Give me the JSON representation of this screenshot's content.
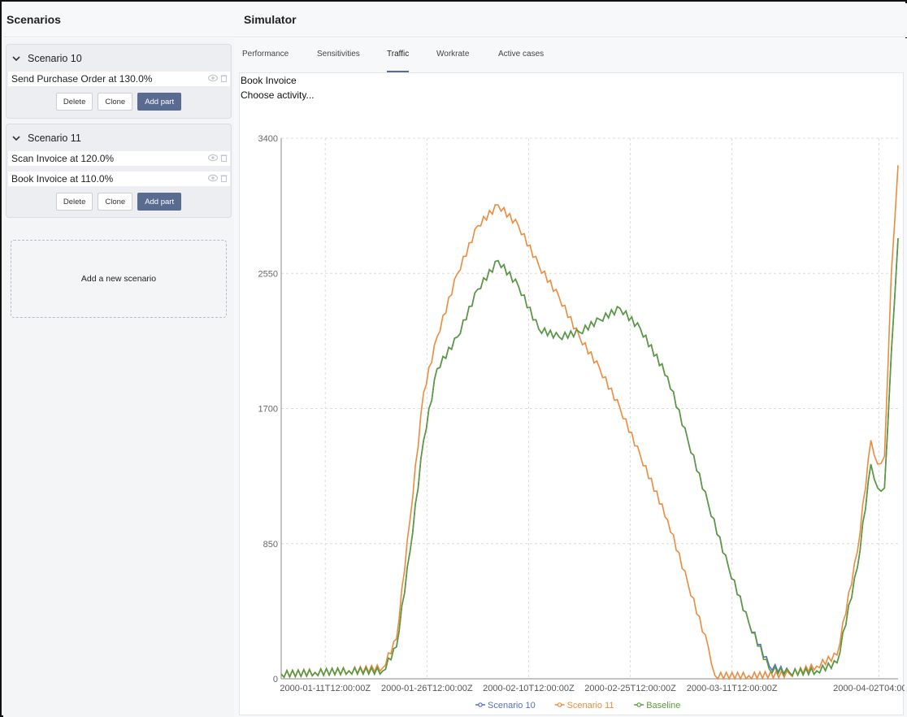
{
  "header": {
    "left_title": "Scenarios",
    "right_title": "Simulator"
  },
  "scenarios": [
    {
      "title": "Scenario 10",
      "parts": [
        {
          "label": "Send Purchase Order at 130.0%"
        }
      ],
      "buttons": {
        "delete": "Delete",
        "clone": "Clone",
        "add": "Add part"
      }
    },
    {
      "title": "Scenario 11",
      "parts": [
        {
          "label": "Scan Invoice at 120.0%"
        },
        {
          "label": "Book Invoice at 110.0%"
        }
      ],
      "buttons": {
        "delete": "Delete",
        "clone": "Clone",
        "add": "Add part"
      }
    }
  ],
  "new_scenario_label": "Add a new scenario",
  "tabs": [
    {
      "label": "Performance",
      "active": false
    },
    {
      "label": "Sensitivities",
      "active": false
    },
    {
      "label": "Traffic",
      "active": true
    },
    {
      "label": "Workrate",
      "active": false
    },
    {
      "label": "Active cases",
      "active": false
    }
  ],
  "activity": {
    "name": "Book Invoice",
    "chooser_placeholder": "Choose activity..."
  },
  "colors": {
    "accent": "#5a6b92",
    "scenario10": "#5470c6",
    "scenario11": "#ee8a3c",
    "baseline": "#5a9a3a"
  },
  "chart_data": {
    "type": "line",
    "title": "",
    "xlabel": "",
    "ylabel": "",
    "ylim": [
      0,
      3400
    ],
    "yticks": [
      0,
      850,
      1700,
      2550,
      3400
    ],
    "xticks": [
      "2000-01-11T12:00:00Z",
      "2000-01-26T12:00:00Z",
      "2000-02-10T12:00:00Z",
      "2000-02-25T12:00:00Z",
      "2000-03-11T12:00:00Z",
      "2000-04-02T04:00:00Z"
    ],
    "x_start": "2000-01-05T00:00:00Z",
    "x_end": "2000-04-05T00:00:00Z",
    "grid": true,
    "legend_position": "bottom-center",
    "series": [
      {
        "name": "Scenario 10",
        "color": "#5470c6",
        "points": [
          [
            "2000-01-05",
            30
          ],
          [
            "2000-01-10",
            40
          ],
          [
            "2000-01-15",
            50
          ],
          [
            "2000-01-20",
            50
          ],
          [
            "2000-01-22",
            200
          ],
          [
            "2000-01-24",
            800
          ],
          [
            "2000-01-26",
            1500
          ],
          [
            "2000-01-28",
            1950
          ],
          [
            "2000-01-31",
            2150
          ],
          [
            "2000-02-03",
            2450
          ],
          [
            "2000-02-06",
            2630
          ],
          [
            "2000-02-09",
            2470
          ],
          [
            "2000-02-12",
            2200
          ],
          [
            "2000-02-15",
            2150
          ],
          [
            "2000-02-18",
            2180
          ],
          [
            "2000-02-21",
            2260
          ],
          [
            "2000-02-24",
            2330
          ],
          [
            "2000-02-27",
            2200
          ],
          [
            "2000-03-02",
            1900
          ],
          [
            "2000-03-05",
            1500
          ],
          [
            "2000-03-08",
            1100
          ],
          [
            "2000-03-11",
            700
          ],
          [
            "2000-03-14",
            350
          ],
          [
            "2000-03-17",
            80
          ],
          [
            "2000-03-20",
            40
          ],
          [
            "2000-03-24",
            50
          ],
          [
            "2000-03-27",
            100
          ],
          [
            "2000-03-30",
            700
          ],
          [
            "2000-04-01",
            1350
          ],
          [
            "2000-04-02",
            1200
          ],
          [
            "2000-04-03",
            1200
          ],
          [
            "2000-04-04",
            2050
          ],
          [
            "2000-04-05",
            2770
          ]
        ]
      },
      {
        "name": "Scenario 11",
        "color": "#ee8a3c",
        "points": [
          [
            "2000-01-05",
            30
          ],
          [
            "2000-01-10",
            40
          ],
          [
            "2000-01-15",
            50
          ],
          [
            "2000-01-20",
            70
          ],
          [
            "2000-01-22",
            250
          ],
          [
            "2000-01-24",
            1000
          ],
          [
            "2000-01-26",
            1800
          ],
          [
            "2000-01-28",
            2150
          ],
          [
            "2000-01-31",
            2550
          ],
          [
            "2000-02-03",
            2850
          ],
          [
            "2000-02-06",
            2980
          ],
          [
            "2000-02-09",
            2850
          ],
          [
            "2000-02-12",
            2600
          ],
          [
            "2000-02-15",
            2400
          ],
          [
            "2000-02-18",
            2150
          ],
          [
            "2000-02-21",
            1950
          ],
          [
            "2000-02-24",
            1700
          ],
          [
            "2000-02-27",
            1400
          ],
          [
            "2000-03-02",
            1000
          ],
          [
            "2000-03-05",
            600
          ],
          [
            "2000-03-08",
            200
          ],
          [
            "2000-03-09",
            20
          ],
          [
            "2000-03-14",
            20
          ],
          [
            "2000-03-20",
            30
          ],
          [
            "2000-03-24",
            80
          ],
          [
            "2000-03-27",
            150
          ],
          [
            "2000-03-30",
            800
          ],
          [
            "2000-04-01",
            1500
          ],
          [
            "2000-04-02",
            1350
          ],
          [
            "2000-04-03",
            1400
          ],
          [
            "2000-04-04",
            2550
          ],
          [
            "2000-04-05",
            3230
          ]
        ]
      },
      {
        "name": "Baseline",
        "color": "#5a9a3a",
        "points": [
          [
            "2000-01-05",
            30
          ],
          [
            "2000-01-10",
            40
          ],
          [
            "2000-01-15",
            50
          ],
          [
            "2000-01-20",
            50
          ],
          [
            "2000-01-22",
            200
          ],
          [
            "2000-01-24",
            800
          ],
          [
            "2000-01-26",
            1500
          ],
          [
            "2000-01-28",
            1950
          ],
          [
            "2000-01-31",
            2150
          ],
          [
            "2000-02-03",
            2450
          ],
          [
            "2000-02-06",
            2630
          ],
          [
            "2000-02-09",
            2470
          ],
          [
            "2000-02-12",
            2200
          ],
          [
            "2000-02-15",
            2150
          ],
          [
            "2000-02-18",
            2180
          ],
          [
            "2000-02-21",
            2260
          ],
          [
            "2000-02-24",
            2330
          ],
          [
            "2000-02-27",
            2200
          ],
          [
            "2000-03-02",
            1900
          ],
          [
            "2000-03-05",
            1500
          ],
          [
            "2000-03-08",
            1100
          ],
          [
            "2000-03-11",
            700
          ],
          [
            "2000-03-14",
            350
          ],
          [
            "2000-03-17",
            60
          ],
          [
            "2000-03-20",
            40
          ],
          [
            "2000-03-24",
            50
          ],
          [
            "2000-03-27",
            100
          ],
          [
            "2000-03-30",
            700
          ],
          [
            "2000-04-01",
            1350
          ],
          [
            "2000-04-02",
            1200
          ],
          [
            "2000-04-03",
            1200
          ],
          [
            "2000-04-04",
            2050
          ],
          [
            "2000-04-05",
            2770
          ]
        ]
      }
    ]
  }
}
